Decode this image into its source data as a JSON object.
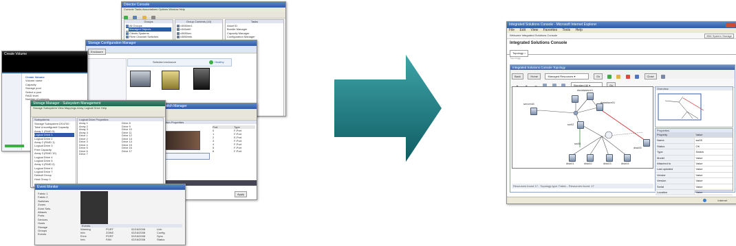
{
  "stack": {
    "w1": {
      "title": "Director Console",
      "menu": "Console  Tasks  Associations  Options  Window  Help",
      "groups_label": "Groups",
      "members_label": "Group Contents (10)",
      "tasks_label": "Tasks",
      "groups": [
        "All Groups",
        "Managed Objects",
        "Clients Systems",
        "Fibre Channel Switches",
        "Storage Subsystems"
      ],
      "members": [
        "x3550ee1",
        "x346dd0",
        "x3650srv",
        "x3850mtk",
        "x3455bf2",
        "bladebb12"
      ],
      "tasks": [
        "Asset ID",
        "Bundle Manager",
        "Capacity Manager",
        "Configuration Manager",
        "Event Log",
        "File Transfer",
        "Hardware Status",
        "Inventory",
        "Network Configuration",
        "Process Management",
        "Remote Control",
        "Remote Session",
        "Resource Monitors",
        "Scheduler",
        "Software Distribution",
        "SNMP Browser",
        "System Accounts",
        "Update Manager"
      ]
    },
    "w2": {
      "title": "Storage Configuration Manager",
      "top_label": "Enclosure",
      "enclosure_label": "Selected enclosure",
      "status": "Healthy"
    },
    "w3": {
      "title": "Create Volume",
      "body_lines": [
        "Create Volume",
        "Volume name",
        "Capacity",
        "Storage pool",
        "Select a pool",
        "RAID level",
        "Number of volumes"
      ]
    },
    "w4": {
      "title": "Storage Manager - Subsystem Management",
      "menu": "Storage Subsystem  View  Mappings  Array  Logical Drive  Help",
      "left_header": "Subsystems",
      "right_header": "Logical Drive Properties",
      "tree": [
        "Storage Subsystem DS4700",
        "Total Unconfigured Capacity",
        "Array 1 (RAID 5)",
        "Logical Drive 1",
        "Logical Drive 2",
        "Array 2 (RAID 1)",
        "Logical Drive 3",
        "Free Capacity",
        "Array 3 (RAID 10)",
        "Logical Drive 4",
        "Logical Drive 5",
        "Array 4 (RAID 0)",
        "Logical Drive 6",
        "Logical Drive 7",
        "Default Group",
        "Host Group 1"
      ],
      "rows": [
        "Array 1",
        "Array 2",
        "Array 3",
        "Array 4",
        "Drive 1",
        "Drive 2",
        "Drive 3",
        "Drive 4",
        "Drive 5",
        "Drive 6",
        "Drive 7",
        "Drive 8",
        "Drive 9",
        "Drive 10",
        "Drive 11",
        "Drive 12",
        "Drive 13",
        "Drive 14",
        "Drive 15",
        "Drive 16",
        "Drive 17"
      ]
    },
    "w5": {
      "title": "Switch Manager",
      "header": "Switch Properties",
      "tab_label": "Ports",
      "cols": [
        "Port",
        "Type",
        "Status",
        "Speed"
      ],
      "rows": [
        [
          "0",
          "F-Port",
          "Online",
          "4 Gb"
        ],
        [
          "1",
          "F-Port",
          "Online",
          "4 Gb"
        ],
        [
          "2",
          "E-Port",
          "Online",
          "4 Gb"
        ],
        [
          "3",
          "F-Port",
          "Offline",
          "Auto"
        ],
        [
          "4",
          "F-Port",
          "Online",
          "2 Gb"
        ],
        [
          "5",
          "F-Port",
          "Online",
          "4 Gb"
        ],
        [
          "6",
          "F-Port",
          "Online",
          "4 Gb"
        ]
      ],
      "button": "Apply"
    },
    "w6": {
      "title": "Event Monitor",
      "header": "Events",
      "rows": [
        [
          "Warning",
          "PORT",
          "02/16/2008",
          "Link"
        ],
        [
          "Info",
          "ZONE",
          "02/16/2008",
          "Config"
        ],
        [
          "Error",
          "PORT",
          "02/16/2008",
          "Sync"
        ],
        [
          "Info",
          "FAN",
          "02/16/2008",
          "Status"
        ],
        [
          "Warning",
          "PSU",
          "02/16/2008",
          "Temp"
        ]
      ],
      "tree": [
        "Fabric 1",
        "Fabric 2",
        "Switches",
        "Zones",
        "Zone Sets",
        "Aliases",
        "Ports",
        "Devices",
        "Hosts",
        "Storage",
        "Groups",
        "Events"
      ]
    }
  },
  "target": {
    "window_title": "Integrated Solutions Console - Microsoft Internet Explorer",
    "menu": [
      "File",
      "Edit",
      "View",
      "Favorites",
      "Tools",
      "Help"
    ],
    "address": "Welcome    Integrated Solutions Console",
    "address_right": "IBM System Storage",
    "app_title": "Integrated Solutions Console",
    "tab": "Topology",
    "breadcrumb": "Topology",
    "panel_title": "Integrated Solutions Console Topology",
    "toolbar_buttons": [
      "Back",
      "Home"
    ],
    "view_select": "Managed Resources",
    "go_button": "Go",
    "close_button": "Close",
    "layout_select": "Standard All",
    "overview_title": "Overview",
    "properties_title": "Properties",
    "prop_header": [
      "Property",
      "Value"
    ],
    "props": [
      [
        "Name",
        "sw05"
      ],
      [
        "Status",
        "OK"
      ],
      [
        "Type",
        "Switch"
      ],
      [
        "Model",
        "Value"
      ],
      [
        "Attached to",
        "Value"
      ],
      [
        "Last updated",
        "Value"
      ],
      [
        "Vendor",
        "Value"
      ],
      [
        "Version",
        "Value"
      ],
      [
        "Serial",
        "Value"
      ],
      [
        "Location",
        "Value"
      ],
      [
        "Description",
        "Value"
      ]
    ],
    "nodes": [
      "dsdatastore1",
      "datastore01",
      "server48",
      "sw05",
      "sw02",
      "disk01",
      "disk02",
      "disk03",
      "disk04",
      "disk05"
    ],
    "status_bar": "Resources found 17 - Topology type: Fabric - Resources found: 17",
    "bottom_status": "Internet"
  },
  "colors": {
    "arrow_top": "#3ea4a8",
    "arrow_bottom": "#0f5c62",
    "title_blue": "#2d5aa8",
    "link_red": "#c62828",
    "link_green": "#2e8b3a"
  }
}
